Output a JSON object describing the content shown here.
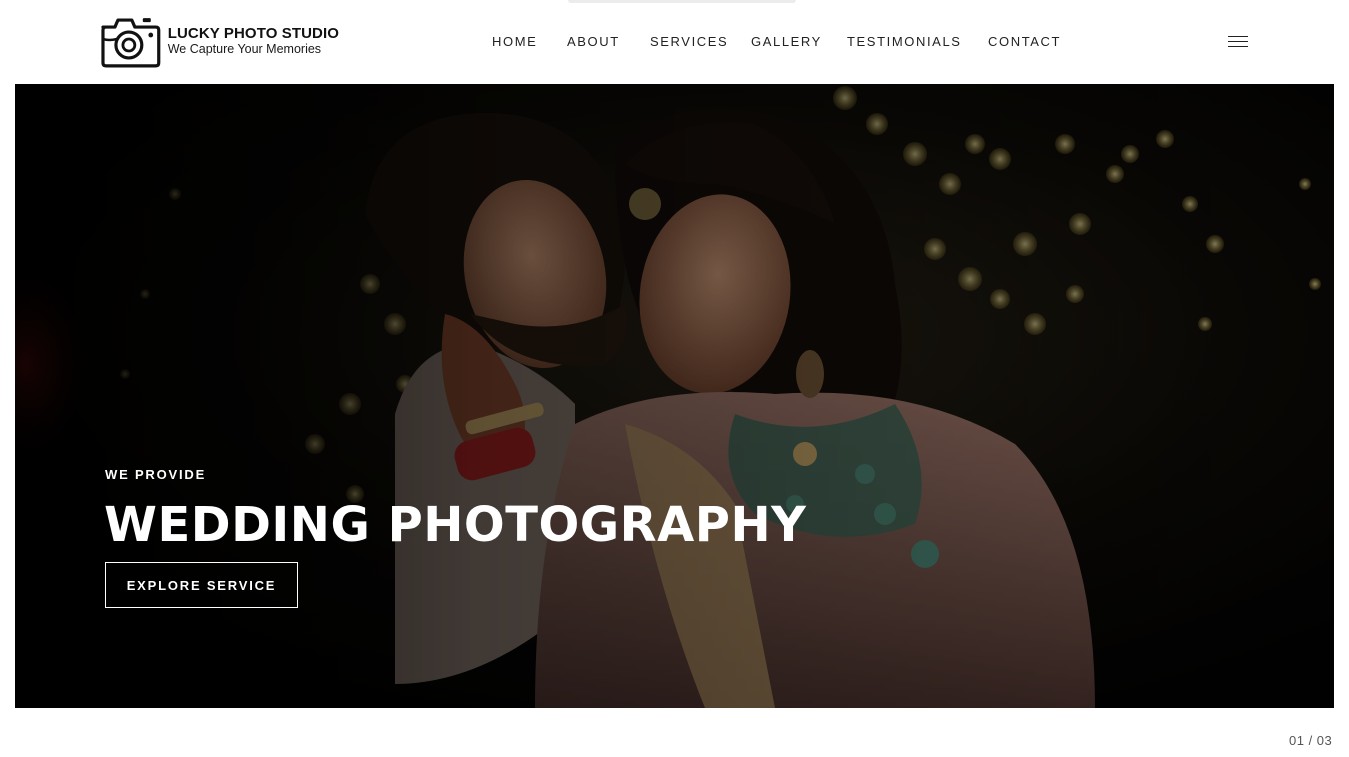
{
  "brand": {
    "name": "LUCKY PHOTO STUDIO",
    "tagline": "We Capture Your Memories",
    "logo_icon": "camera-icon"
  },
  "nav": {
    "items": [
      {
        "label": "HOME"
      },
      {
        "label": "ABOUT"
      },
      {
        "label": "SERVICES"
      },
      {
        "label": "GALLERY"
      },
      {
        "label": "TESTIMONIALS"
      },
      {
        "label": "CONTACT"
      }
    ],
    "menu_icon": "hamburger-menu-icon"
  },
  "hero": {
    "eyebrow": "WE PROVIDE",
    "title": "WEDDING PHOTOGRAPHY",
    "button_label": "EXPLORE SERVICE",
    "image_subject": "bride-and-groom-photo"
  },
  "slider": {
    "counter": "01 / 03"
  },
  "colors": {
    "header_bg": "#ffffff",
    "text_dark": "#222222",
    "hero_text": "#ffffff",
    "counter_text": "#555555"
  }
}
